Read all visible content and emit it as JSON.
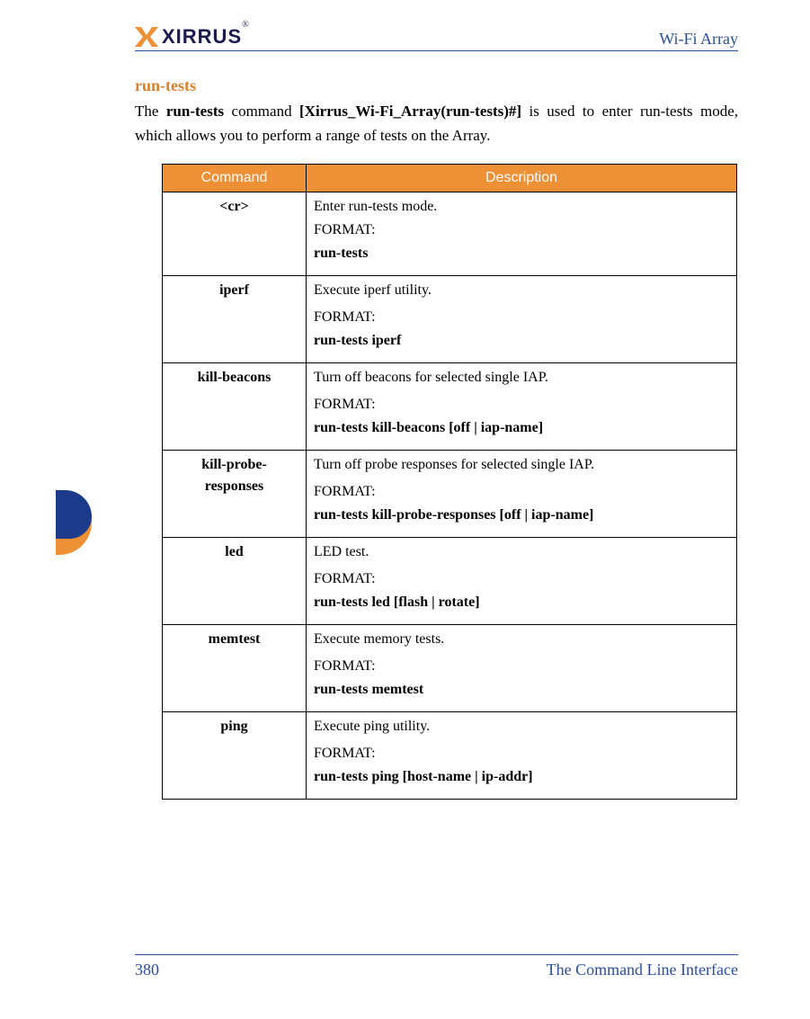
{
  "header": {
    "logo_text": "XIRRUS",
    "product": "Wi-Fi Array"
  },
  "section": {
    "heading": "run-tests",
    "intro_parts": {
      "p1": "The ",
      "b1": "run-tests",
      "p2": " command ",
      "b2": "[Xirrus_Wi-Fi_Array(run-tests)#]",
      "p3": " is used to enter run-tests mode, which allows you to perform a range of tests on the Array."
    }
  },
  "table": {
    "headers": {
      "command": "Command",
      "description": "Description"
    },
    "rows": [
      {
        "command": "<cr>",
        "desc": "Enter run-tests mode.",
        "format_label": "FORMAT:",
        "format_value": "run-tests",
        "spaced": false
      },
      {
        "command": "iperf",
        "desc": " Execute iperf utility.",
        "format_label": "FORMAT:",
        "format_value": "run-tests iperf",
        "spaced": true
      },
      {
        "command": "kill-beacons",
        "desc": "Turn off beacons for selected single IAP.",
        "format_label": "FORMAT:",
        "format_value": "run-tests kill-beacons [off | iap-name]",
        "spaced": true
      },
      {
        "command": "kill-probe-responses",
        "desc": " Turn off probe responses for selected single IAP.",
        "format_label": "FORMAT:",
        "format_value": "run-tests kill-probe-responses [off | iap-name]",
        "spaced": true
      },
      {
        "command": "led",
        "desc": "LED test.",
        "format_label": "FORMAT:",
        "format_value": "run-tests led [flash | rotate]",
        "spaced": true
      },
      {
        "command": "memtest",
        "desc": " Execute memory tests.",
        "format_label": "FORMAT:",
        "format_value": "run-tests memtest",
        "spaced": true
      },
      {
        "command": "ping",
        "desc": " Execute ping utility.",
        "format_label": "FORMAT:",
        "format_value": "run-tests ping [host-name | ip-addr]",
        "spaced": true
      }
    ]
  },
  "footer": {
    "page_number": "380",
    "chapter": "The Command Line Interface"
  }
}
